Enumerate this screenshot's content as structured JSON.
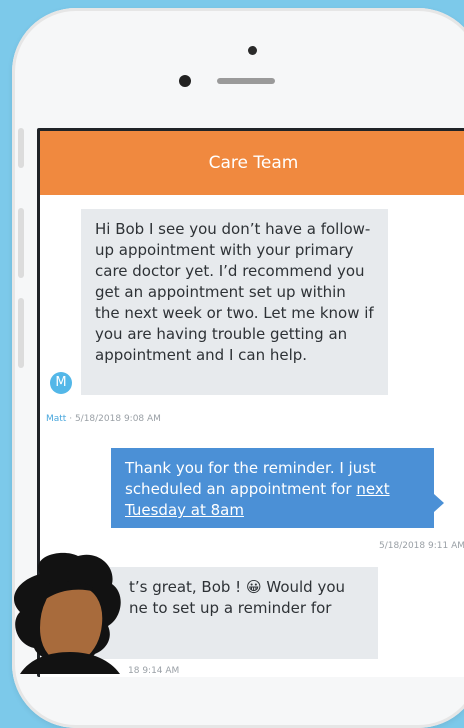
{
  "header": {
    "title": "Care Team"
  },
  "messages": [
    {
      "direction": "incoming",
      "avatar_initial": "M",
      "text": "Hi Bob I see you don’t have a follow-up appointment with your primary care doctor yet. I’d recommend you get an appointment set up within the next week or two. Let me know if you are having trouble getting an appointment and I can help.",
      "author": "Matt",
      "separator": " · ",
      "timestamp": "5/18/2018 9:08 AM"
    },
    {
      "direction": "outgoing",
      "text_before_link": "Thank you for the reminder. I just scheduled an appointment for ",
      "link_text": "next Tuesday at 8am",
      "timestamp": "5/18/2018 9:11 AM"
    },
    {
      "direction": "incoming",
      "text_line1": "t’s great, Bob ! 😀 Would you",
      "text_line2": "ne to set up a reminder for",
      "timestamp_partial": "18 9:14 AM"
    }
  ],
  "colors": {
    "background": "#7cc9ea",
    "header": "#f0893f",
    "incoming_bubble": "#e7eaed",
    "outgoing_bubble": "#4b90d6",
    "author": "#49a7dd"
  }
}
